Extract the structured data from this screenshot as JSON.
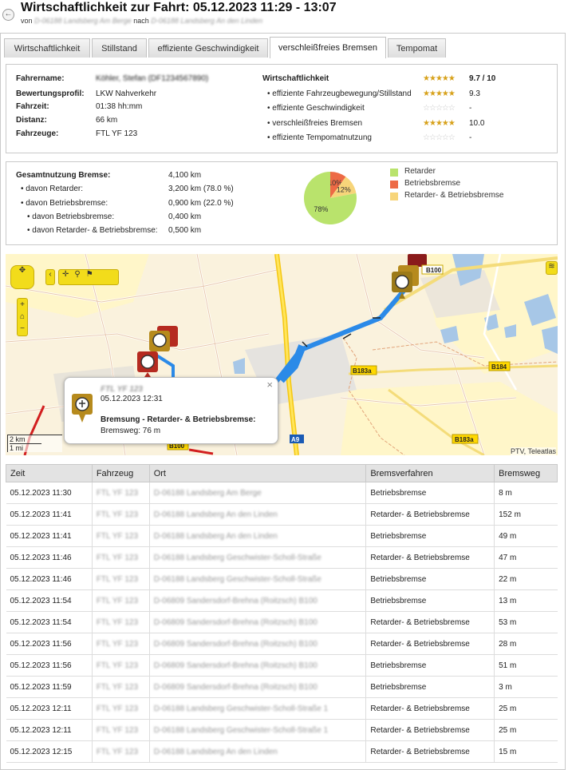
{
  "header": {
    "title": "Wirtschaftlichkeit zur Fahrt: 05.12.2023 11:29 - 13:07",
    "subtitle_prefix": "von",
    "from": "D-06188 Landsberg Am Berge",
    "subtitle_mid": "nach",
    "to": "D-06188 Landsberg An den Linden",
    "back_icon": "back-arrow-icon"
  },
  "tabs": [
    {
      "label": "Wirtschaftlichkeit"
    },
    {
      "label": "Stillstand"
    },
    {
      "label": "effiziente Geschwindigkeit"
    },
    {
      "label": "verschleißfreies Bremsen"
    },
    {
      "label": "Tempomat"
    }
  ],
  "summary": {
    "driver_label": "Fahrername:",
    "driver_value": "Köhler, Stefan (DF1234567890)",
    "profile_label": "Bewertungsprofil:",
    "profile_value": "LKW Nahverkehr",
    "time_label": "Fahrzeit:",
    "time_value": "01:38 hh:mm",
    "distance_label": "Distanz:",
    "distance_value": "66 km",
    "vehicles_label": "Fahrzeuge:",
    "vehicles_value": "FTL YF 123",
    "econ_label": "Wirtschaftlichkeit",
    "econ_score": "9.7 / 10",
    "econ_stars": 5,
    "ratings": [
      {
        "label": "effiziente Fahrzeugbewegung/Stillstand",
        "stars": 4.5,
        "value": "9.3"
      },
      {
        "label": "effiziente Geschwindigkeit",
        "stars": 0,
        "value": "-"
      },
      {
        "label": "verschleißfreies Bremsen",
        "stars": 5,
        "value": "10.0"
      },
      {
        "label": "effiziente Tempomatnutzung",
        "stars": 0,
        "value": "-"
      }
    ]
  },
  "brakes": {
    "total_label": "Gesamtnutzung Bremse:",
    "total_value": "4,100 km",
    "retarder_label": "davon Retarder:",
    "retarder_value": "3,200 km (78.0 %)",
    "service_label": "davon Betriebsbremse:",
    "service_value": "0,900 km (22.0 %)",
    "service_only_label": "davon Betriebsbremse:",
    "service_only_value": "0,400 km",
    "combined_label": "davon Retarder- & Betriebsbremse:",
    "combined_value": "0,500 km"
  },
  "chart_data": {
    "type": "pie",
    "slices": [
      {
        "name": "Retarder",
        "value": 78,
        "label": "78%",
        "color": "#b9e36c"
      },
      {
        "name": "Betriebsbremse",
        "value": 10,
        "label": "10%",
        "color": "#ed6a45"
      },
      {
        "name": "Retarder- & Betriebsbremse",
        "value": 12,
        "label": "12%",
        "color": "#f7d57a"
      }
    ],
    "legend_position": "right"
  },
  "map": {
    "roads": {
      "a9": "A9",
      "b100_top": "B100",
      "b100_bottom": "B100",
      "b183a_mid": "B183a",
      "b183a_bottom": "B183a",
      "b184": "B184"
    },
    "scale_km": "2 km",
    "scale_mi": "1 mi",
    "attribution": "PTV, Teleatlas",
    "popup": {
      "vehicle": "FTL YF 123",
      "timestamp": "05.12.2023 12:31",
      "event": "Bremsung - Retarder- & Betriebsbremse:",
      "distance": "Bremsweg: 76 m",
      "close": "×"
    }
  },
  "table": {
    "headers": [
      "Zeit",
      "Fahrzeug",
      "Ort",
      "Bremsverfahren",
      "Bremsweg"
    ],
    "rows": [
      {
        "time": "05.12.2023 11:30",
        "vehicle": "FTL YF 123",
        "place": "D-06188 Landsberg Am Berge",
        "method": "Betriebsbremse",
        "distance": "8 m"
      },
      {
        "time": "05.12.2023 11:41",
        "vehicle": "FTL YF 123",
        "place": "D-06188 Landsberg An den Linden",
        "method": "Retarder- & Betriebsbremse",
        "distance": "152 m"
      },
      {
        "time": "05.12.2023 11:41",
        "vehicle": "FTL YF 123",
        "place": "D-06188 Landsberg An den Linden",
        "method": "Betriebsbremse",
        "distance": "49 m"
      },
      {
        "time": "05.12.2023 11:46",
        "vehicle": "FTL YF 123",
        "place": "D-06188 Landsberg Geschwister-Scholl-Straße",
        "method": "Retarder- & Betriebsbremse",
        "distance": "47 m"
      },
      {
        "time": "05.12.2023 11:46",
        "vehicle": "FTL YF 123",
        "place": "D-06188 Landsberg Geschwister-Scholl-Straße",
        "method": "Betriebsbremse",
        "distance": "22 m"
      },
      {
        "time": "05.12.2023 11:54",
        "vehicle": "FTL YF 123",
        "place": "D-06809 Sandersdorf-Brehna (Roitzsch) B100",
        "method": "Betriebsbremse",
        "distance": "13 m"
      },
      {
        "time": "05.12.2023 11:54",
        "vehicle": "FTL YF 123",
        "place": "D-06809 Sandersdorf-Brehna (Roitzsch) B100",
        "method": "Retarder- & Betriebsbremse",
        "distance": "53 m"
      },
      {
        "time": "05.12.2023 11:56",
        "vehicle": "FTL YF 123",
        "place": "D-06809 Sandersdorf-Brehna (Roitzsch) B100",
        "method": "Retarder- & Betriebsbremse",
        "distance": "28 m"
      },
      {
        "time": "05.12.2023 11:56",
        "vehicle": "FTL YF 123",
        "place": "D-06809 Sandersdorf-Brehna (Roitzsch) B100",
        "method": "Betriebsbremse",
        "distance": "51 m"
      },
      {
        "time": "05.12.2023 11:59",
        "vehicle": "FTL YF 123",
        "place": "D-06809 Sandersdorf-Brehna (Roitzsch) B100",
        "method": "Betriebsbremse",
        "distance": "3 m"
      },
      {
        "time": "05.12.2023 12:11",
        "vehicle": "FTL YF 123",
        "place": "D-06188 Landsberg Geschwister-Scholl-Straße 1",
        "method": "Retarder- & Betriebsbremse",
        "distance": "25 m"
      },
      {
        "time": "05.12.2023 12:11",
        "vehicle": "FTL YF 123",
        "place": "D-06188 Landsberg Geschwister-Scholl-Straße 1",
        "method": "Retarder- & Betriebsbremse",
        "distance": "25 m"
      },
      {
        "time": "05.12.2023 12:15",
        "vehicle": "FTL YF 123",
        "place": "D-06188 Landsberg An den Linden",
        "method": "Retarder- & Betriebsbremse",
        "distance": "15 m"
      }
    ]
  }
}
